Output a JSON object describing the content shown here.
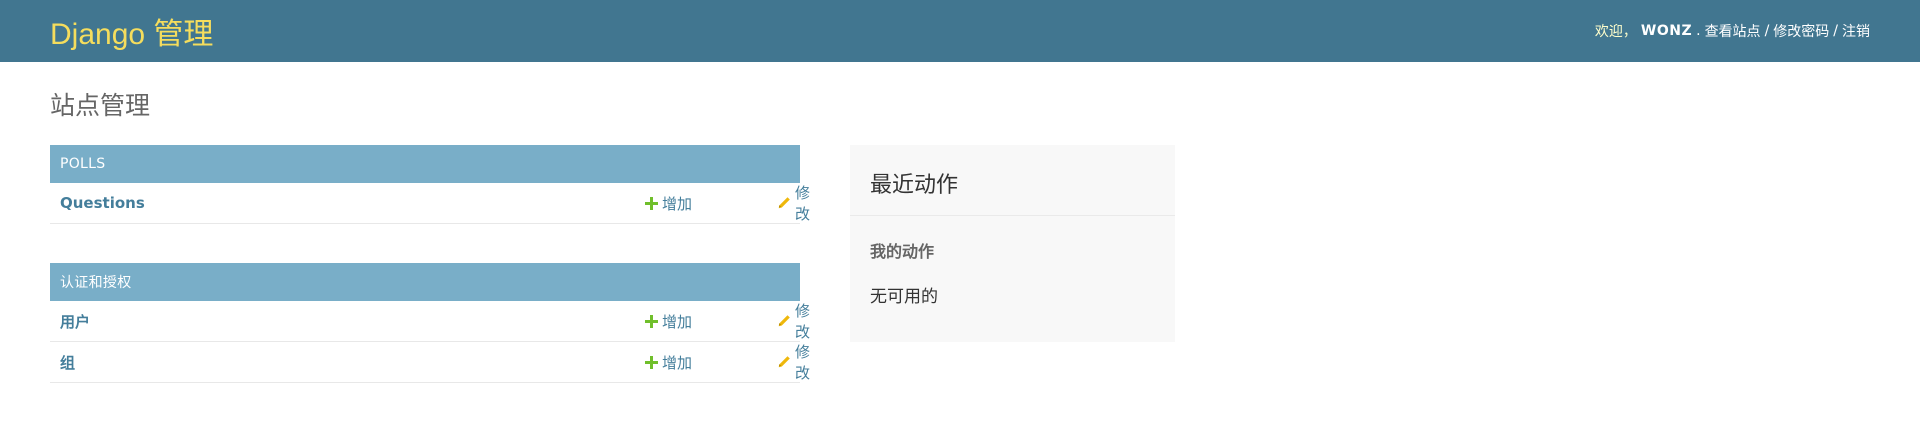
{
  "header": {
    "branding": "Django 管理",
    "welcome": "欢迎，",
    "username": "WONZ",
    "view_site": "查看站点",
    "change_password": "修改密码",
    "logout": "注销",
    "separator": "/"
  },
  "page_title": "站点管理",
  "modules": [
    {
      "caption": "POLLS",
      "rows": [
        {
          "name": "Questions",
          "add": "增加",
          "change": "修改"
        }
      ]
    },
    {
      "caption": "认证和授权",
      "rows": [
        {
          "name": "用户",
          "add": "增加",
          "change": "修改"
        },
        {
          "name": "组",
          "add": "增加",
          "change": "修改"
        }
      ]
    }
  ],
  "recent_actions": {
    "title": "最近动作",
    "subtitle": "我的动作",
    "empty": "无可用的"
  },
  "colors": {
    "header_bg": "#417690",
    "branding": "#f5dd5d",
    "caption_bg": "#79aec8",
    "link": "#447e9b",
    "add_icon": "#70bf2b",
    "change_icon": "#efb80b"
  },
  "icons": {
    "add": "plus-icon",
    "change": "pencil-icon"
  }
}
